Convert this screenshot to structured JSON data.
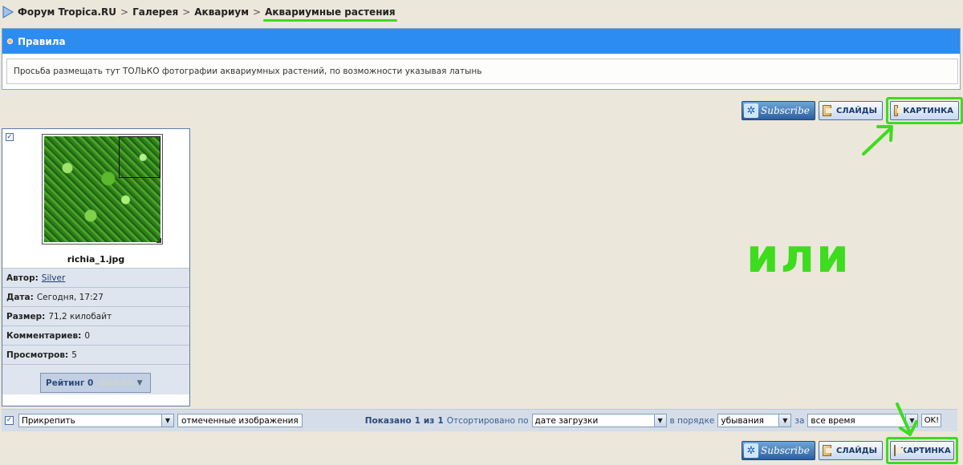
{
  "breadcrumb": {
    "items": [
      "Форум Tropica.RU",
      "Галерея",
      "Аквариум"
    ],
    "separator": ">",
    "current": "Аквариумные растения"
  },
  "rules": {
    "title": "Правила",
    "text": "Просьба размещать тут ТОЛЬКО фотографии аквариумных растений, по возможности указывая латынь"
  },
  "view_buttons": {
    "subscribe": "Subscribe",
    "slides": "СЛАЙДЫ",
    "picture": "КАРТИНКА"
  },
  "image_card": {
    "filename": "richia_1.jpg",
    "author_label": "Автор:",
    "author": "Silver",
    "date_label": "Дата:",
    "date": "Сегодня, 17:27",
    "size_label": "Размер:",
    "size": "71,2 килобайт",
    "comments_label": "Комментариев:",
    "comments": "0",
    "views_label": "Просмотров:",
    "views": "5",
    "rating_label": "Рейтинг 0",
    "stars": "☆☆☆☆☆"
  },
  "annotation": {
    "or_text": "или",
    "accent_color": "#3ddc1e"
  },
  "bottom_bar": {
    "action_select": "Прикрепить",
    "action_button": "отмеченные изображения",
    "shown_prefix": "Показано",
    "shown_from": "1",
    "shown_of": "из",
    "shown_total": "1",
    "sorted_label": "Отсортировано по",
    "sort_select": "дате загрузки",
    "order_label": "в порядке",
    "order_select": "убывания",
    "period_label": "за",
    "period_select": "все время",
    "ok": "OK!"
  },
  "colors": {
    "header_blue": "#2d8cf0",
    "page_bg": "#ebe7da"
  }
}
